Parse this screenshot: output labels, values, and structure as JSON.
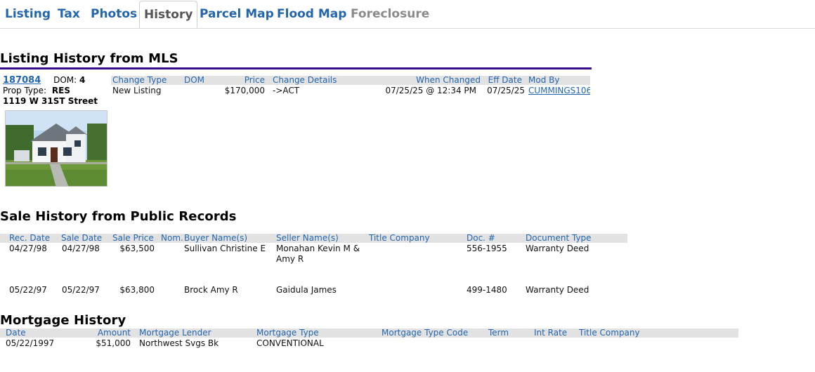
{
  "tabs": [
    {
      "label": "Listing"
    },
    {
      "label": "Tax"
    },
    {
      "label": "Photos"
    },
    {
      "label": "History"
    },
    {
      "label": "Parcel Map"
    },
    {
      "label": "Flood Map"
    },
    {
      "label": "Foreclosure"
    }
  ],
  "listing_history": {
    "title": "Listing History from MLS",
    "mls_number": "187084",
    "dom_label": "DOM:",
    "dom_value": "4",
    "prop_type_label": "Prop Type:",
    "prop_type_value": "RES",
    "address": "1119 W 31ST Street",
    "columns": [
      "Change Type",
      "DOM",
      "Price",
      "Change Details",
      "When Changed",
      "Eff Date",
      "Mod By"
    ],
    "rows": [
      {
        "change_type": "New Listing",
        "dom": "",
        "price": "$170,000",
        "details": "->ACT",
        "when_changed": "07/25/25 @ 12:34 PM",
        "eff_date": "07/25/25",
        "mod_by": "CUMMINGS106"
      }
    ]
  },
  "sale_history": {
    "title": "Sale History from Public Records",
    "columns": [
      "Rec. Date",
      "Sale Date",
      "Sale Price",
      "Nom.",
      "Buyer Name(s)",
      "Seller Name(s)",
      "Title Company",
      "Doc. #",
      "Document Type"
    ],
    "rows": [
      {
        "rec_date": "04/27/98",
        "sale_date": "04/27/98",
        "price": "$63,500",
        "nom": "",
        "buyer": "Sullivan Christine E",
        "seller_1": "Monahan Kevin M &",
        "seller_2": "Amy R",
        "title_co": "",
        "doc": "556-1955",
        "doc_type": "Warranty Deed"
      },
      {
        "rec_date": "05/22/97",
        "sale_date": "05/22/97",
        "price": "$63,800",
        "nom": "",
        "buyer": "Brock Amy R",
        "seller_1": "Gaidula James",
        "seller_2": "",
        "title_co": "",
        "doc": "499-1480",
        "doc_type": "Warranty Deed"
      }
    ]
  },
  "mortgage_history": {
    "title": "Mortgage History",
    "columns": [
      "Date",
      "Amount",
      "Mortgage Lender",
      "Mortgage Type",
      "Mortgage Type Code",
      "Term",
      "Int Rate",
      "Title Company"
    ],
    "rows": [
      {
        "date": "05/22/1997",
        "amount": "$51,000",
        "lender": "Northwest Svgs Bk",
        "type": "CONVENTIONAL",
        "type_code": "",
        "term": "",
        "rate": "",
        "title_co": ""
      }
    ]
  },
  "colors": {
    "link": "#2466ae",
    "rule": "#3a0d8c",
    "header_bg": "#e2e2e2"
  }
}
